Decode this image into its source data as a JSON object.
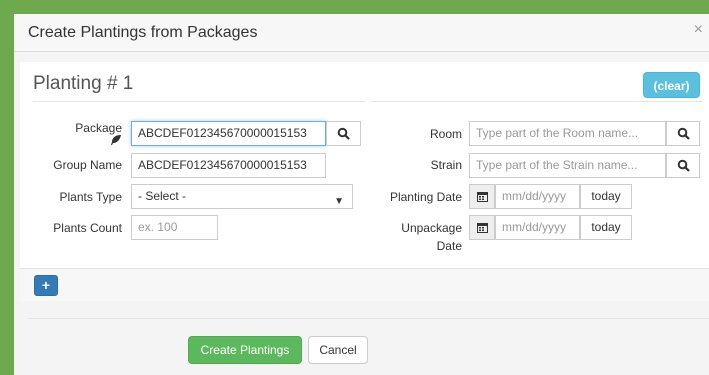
{
  "modal": {
    "title": "Create Plantings from Packages",
    "close": "×"
  },
  "planting": {
    "title": "Planting # 1",
    "clear_label": "(clear)"
  },
  "left": {
    "package": {
      "label": "Package",
      "value": "ABCDEF012345670000015153"
    },
    "group_name": {
      "label": "Group Name",
      "value": "ABCDEF012345670000015153"
    },
    "plants_type": {
      "label": "Plants Type",
      "value": "- Select -"
    },
    "plants_count": {
      "label": "Plants Count",
      "placeholder": "ex. 100"
    }
  },
  "right": {
    "room": {
      "label": "Room",
      "placeholder": "Type part of the Room name..."
    },
    "strain": {
      "label": "Strain",
      "placeholder": "Type part of the Strain name..."
    },
    "planting_date": {
      "label": "Planting Date",
      "placeholder": "mm/dd/yyyy",
      "today_label": "today"
    },
    "unpackage_date": {
      "label_line1": "Unpackage",
      "label_line2": "Date",
      "placeholder": "mm/dd/yyyy",
      "today_label": "today"
    }
  },
  "actions": {
    "add": "+",
    "create": "Create Plantings",
    "cancel": "Cancel"
  }
}
